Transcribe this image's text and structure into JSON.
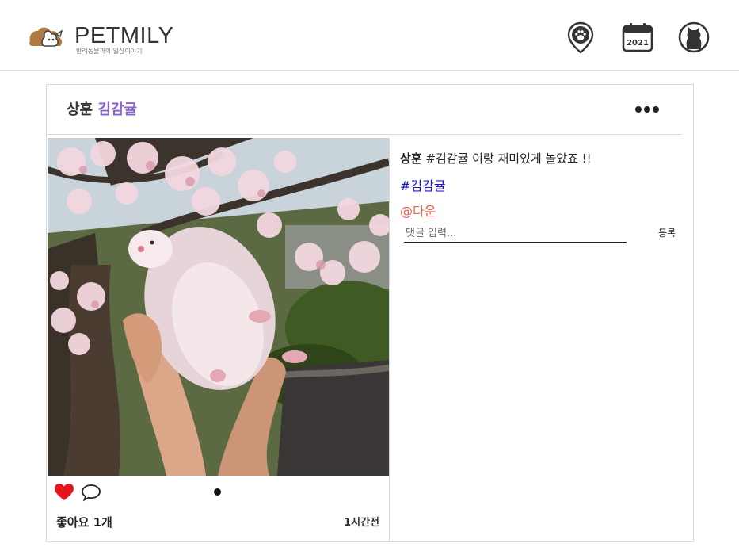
{
  "header": {
    "logo_text": "PETMILY",
    "logo_subtitle": "반려동물과의 일상이야기",
    "calendar_year": "2021",
    "icons": [
      "paw-location-icon",
      "calendar-icon",
      "cat-profile-icon"
    ]
  },
  "post": {
    "author": "상훈",
    "pet_name": "김감귤",
    "caption_author": "상훈",
    "caption_text": "#김감귤 이랑 재미있게 놀았죠 !!",
    "hashtag": "#김감귤",
    "mention": "@다운",
    "comment_placeholder": "댓글 입력...",
    "comment_submit": "등록",
    "likes": "좋아요 1개",
    "time_ago": "1시간전",
    "liked": true
  },
  "colors": {
    "pet_name": "#8a63d2",
    "hashtag": "#1a17d9",
    "mention": "#ee5b4c",
    "heart": "#e8141b"
  }
}
